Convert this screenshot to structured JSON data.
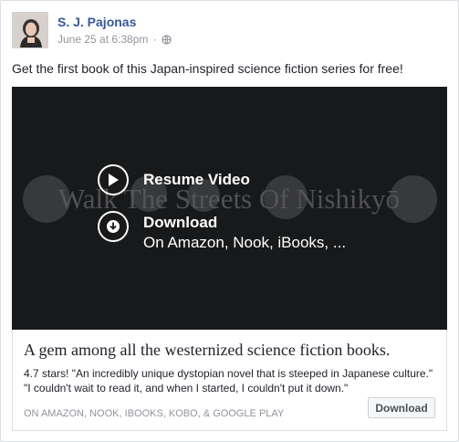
{
  "post": {
    "author": "S. J. Pajonas",
    "timestamp": "June 25 at 6:38pm",
    "separator": "·",
    "privacy_icon": "globe-icon",
    "text": "Get the first book of this Japan-inspired science fiction series for free!"
  },
  "video": {
    "watermark": "Walk The Streets Of Nishikyō",
    "resume_label": "Resume Video",
    "download_label": "Download",
    "download_sub": "On Amazon, Nook, iBooks, ..."
  },
  "card": {
    "title": "A gem among all the westernized science fiction books.",
    "description": "4.7 stars! \"An incredibly unique dystopian novel that is steeped in Japanese culture.\" \"I couldn't wait to read it, and when I started, I couldn't put it down.\"",
    "source": "ON AMAZON, NOOK, IBOOKS, KOBO, & GOOGLE PLAY",
    "button_label": "Download"
  },
  "colors": {
    "link": "#365899",
    "muted": "#90949c",
    "video_bg": "#18191a"
  }
}
